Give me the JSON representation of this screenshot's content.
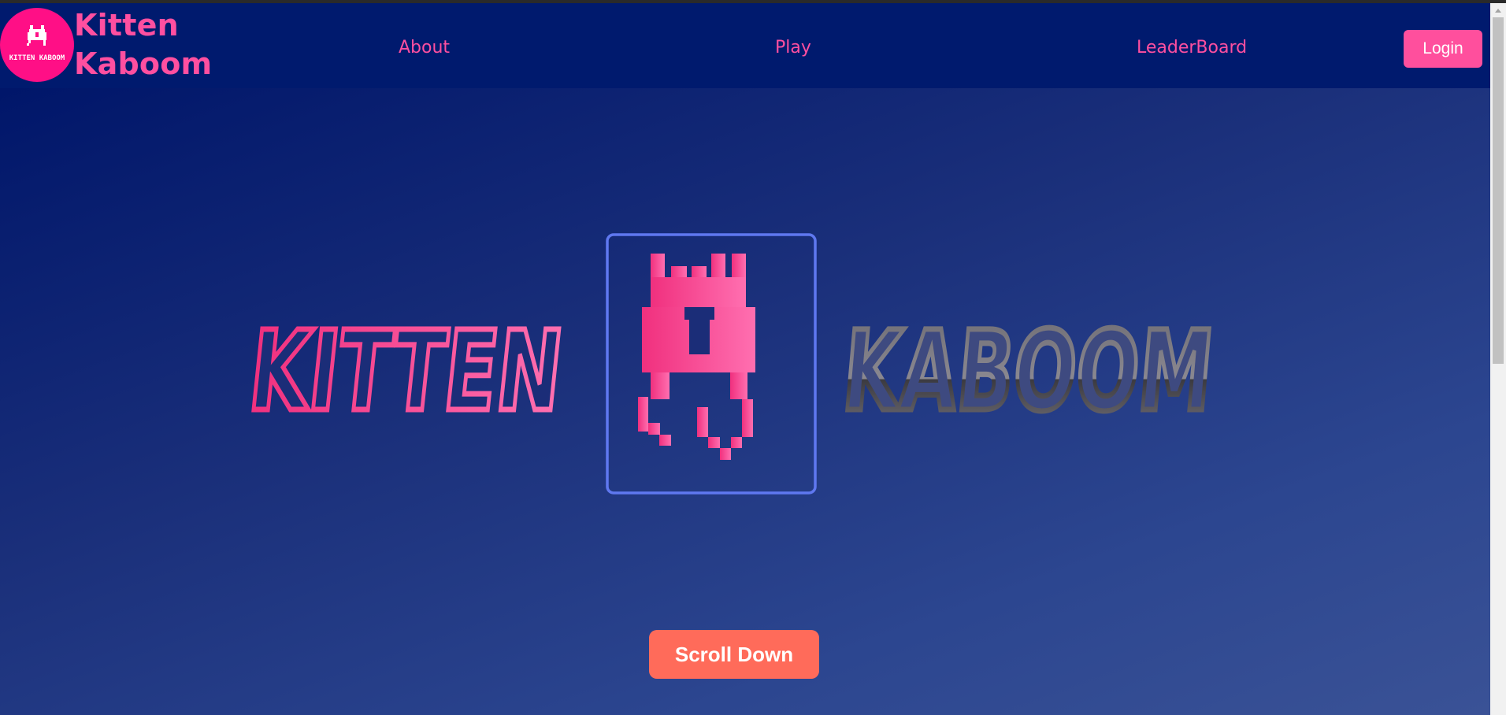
{
  "brand": {
    "name_line1": "Kitten",
    "name_line2": "Kaboom",
    "logo_text": "KITTEN KABOOM"
  },
  "nav": {
    "links": [
      "About",
      "Play",
      "LeaderBoard"
    ],
    "login_label": "Login"
  },
  "hero": {
    "word_left": "KITTEN",
    "word_right": "KABOOM",
    "scroll_label": "Scroll Down"
  },
  "colors": {
    "navbar_bg": "#001a6e",
    "accent_pink": "#ff4fa0",
    "logo_circle": "#ff0f86",
    "scroll_button": "#ff6b5a",
    "hero_frame": "#5f78f0"
  }
}
